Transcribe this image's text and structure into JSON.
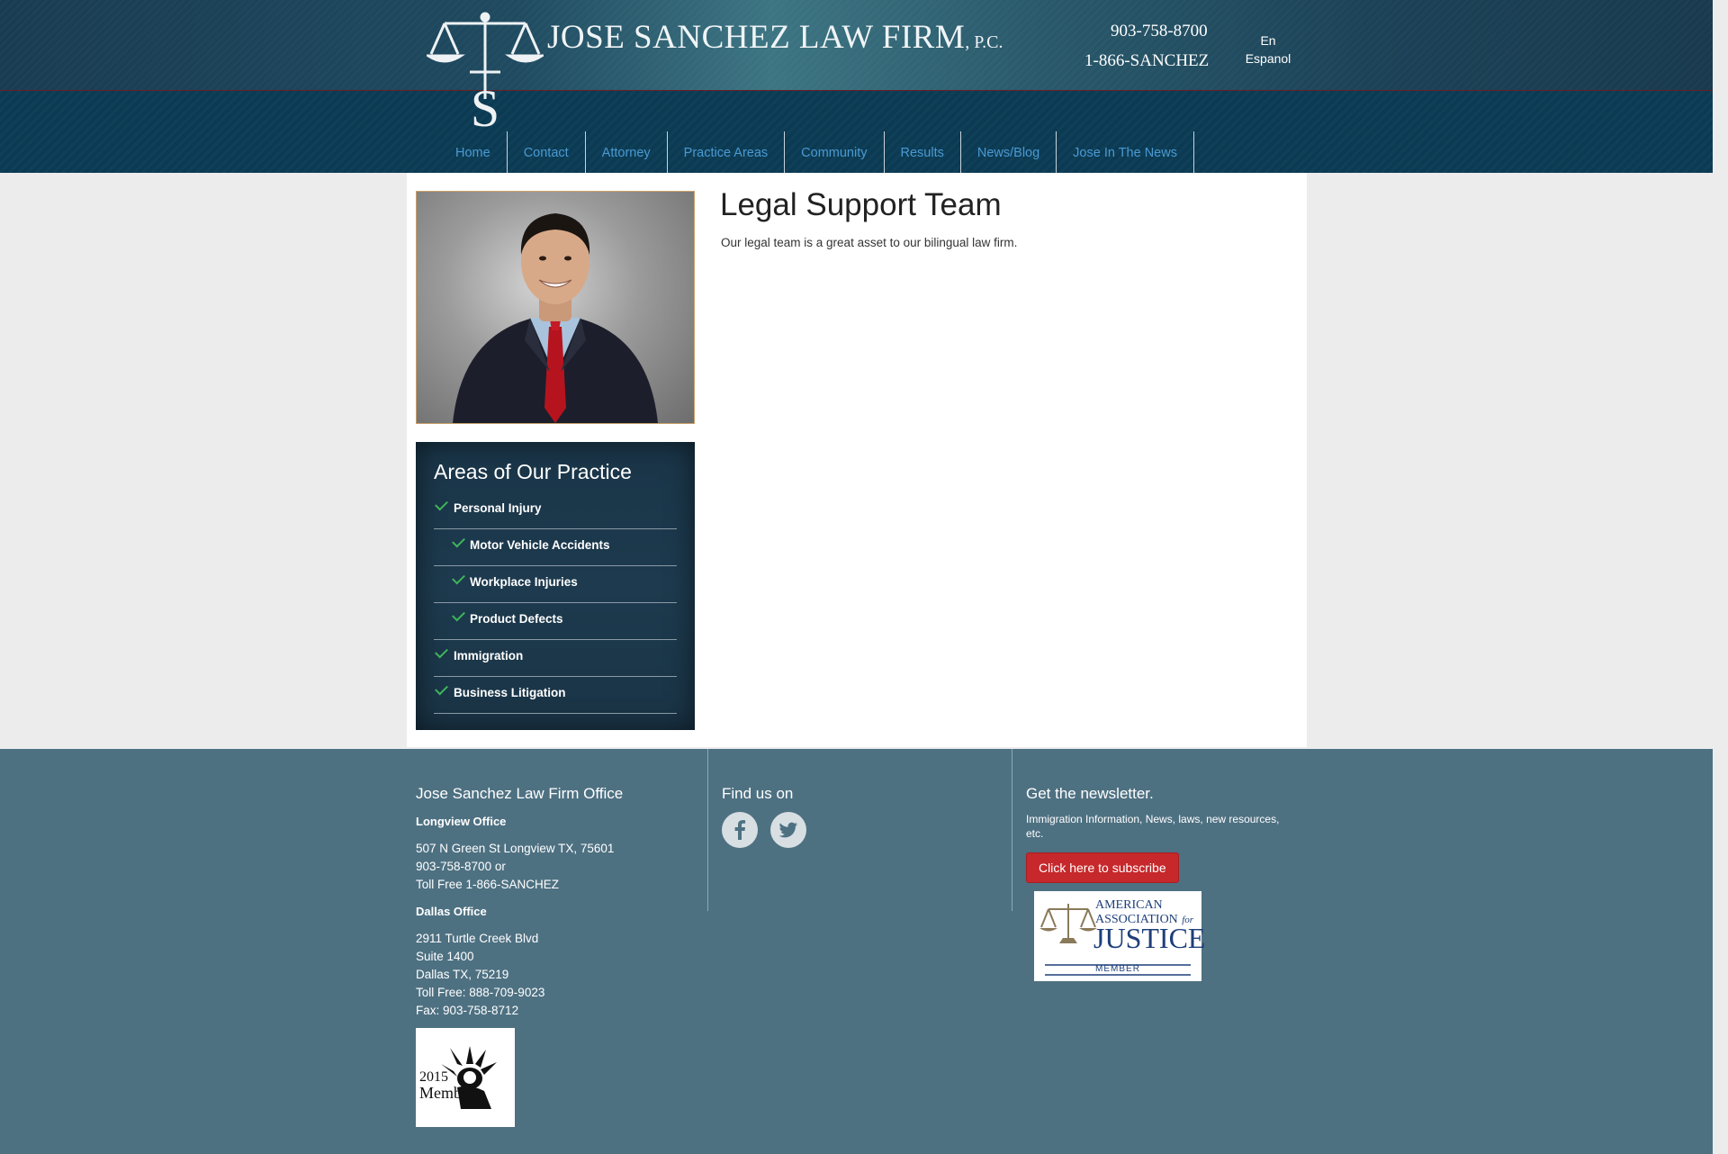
{
  "header": {
    "firm_name": "JOSE SANCHEZ LAW FIRM",
    "firm_suffix": ", P.C.",
    "phone_primary": "903-758-8700",
    "phone_tollfree": "1-866-SANCHEZ",
    "languages": [
      "En",
      "Espanol"
    ]
  },
  "nav": {
    "items": [
      "Home",
      "Contact",
      "Attorney",
      "Practice Areas",
      "Community",
      "Results",
      "News/Blog",
      "Jose In The News"
    ]
  },
  "main": {
    "title": "Legal Support Team",
    "intro": "Our legal team is a great asset to our bilingual law firm."
  },
  "sidebar": {
    "practice_title": "Areas of Our Practice",
    "practice_items": [
      {
        "label": "Personal Injury",
        "level": 0
      },
      {
        "label": "Motor Vehicle Accidents",
        "level": 1
      },
      {
        "label": "Workplace Injuries",
        "level": 1
      },
      {
        "label": "Product Defects",
        "level": 1
      },
      {
        "label": "Immigration",
        "level": 0
      },
      {
        "label": "Business Litigation",
        "level": 0
      }
    ]
  },
  "footer": {
    "office_title": "Jose Sanchez Law Firm Office",
    "longview": {
      "name": "Longview Office",
      "lines": [
        "507 N Green St Longview TX, 75601",
        "903-758-8700 or",
        "Toll Free 1-866-SANCHEZ"
      ]
    },
    "dallas": {
      "name": "Dallas Office",
      "lines": [
        "2911 Turtle Creek Blvd",
        "Suite 1400",
        "Dallas TX, 75219",
        "Toll Free: 888-709-9023",
        "Fax: 903-758-8712"
      ]
    },
    "find_us_title": "Find us on",
    "social_icons": [
      "facebook-icon",
      "twitter-icon"
    ],
    "newsletter_title": "Get the newsletter.",
    "newsletter_desc": "Immigration Information, News, laws, new resources, etc.",
    "subscribe_label": "Click here to subscribe",
    "aaj_badge": {
      "line1": "AMERICAN",
      "line2": "ASSOCIATION",
      "line2b": "for",
      "line3": "JUSTICE",
      "line4": "MEMBER"
    },
    "aila_badge": {
      "year": "2015",
      "label": "Member"
    }
  },
  "colors": {
    "header_dark": "#1a3c52",
    "nav_link": "#4a9ad3",
    "footer_bg": "#4e7182",
    "subscribe_red": "#c6282b",
    "check_green": "#3fb55a"
  }
}
